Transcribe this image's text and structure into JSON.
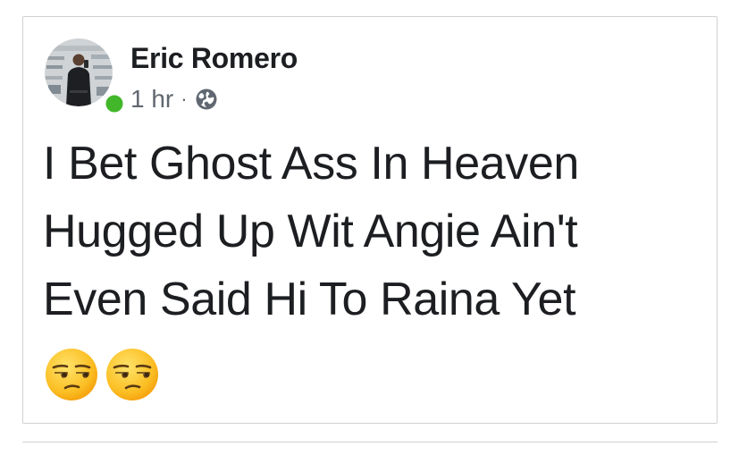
{
  "post": {
    "author": "Eric Romero",
    "time": "1 hr",
    "separator": "·",
    "privacy_icon": "globe-icon",
    "online_status": "online",
    "text_lines": [
      "I Bet Ghost Ass In Heaven",
      "Hugged Up Wit Angie Ain't",
      "Even Said Hi To Raina Yet"
    ],
    "emojis": [
      "unamused-face",
      "unamused-face"
    ]
  },
  "colors": {
    "name": "#1c1e21",
    "meta": "#606770",
    "online": "#42b72a",
    "border": "#d0d1d5"
  }
}
